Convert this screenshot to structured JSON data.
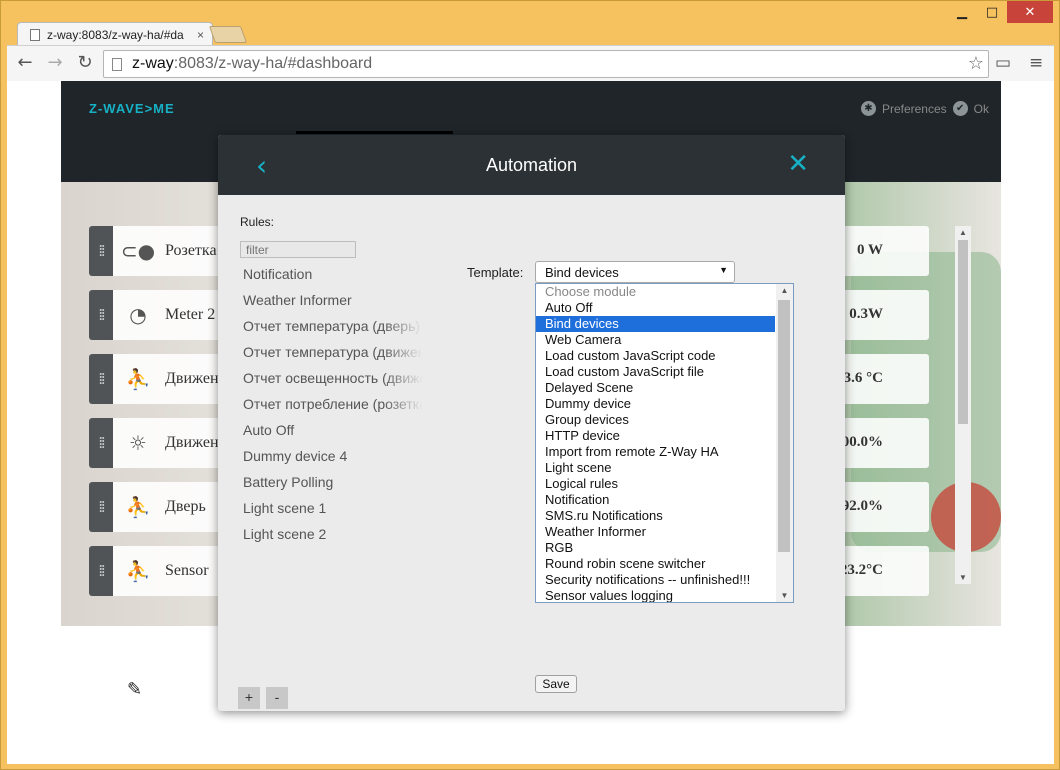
{
  "browser": {
    "tab_title": "z-way:8083/z-way-ha/#da",
    "tab_close": "×",
    "url_host": "z-way",
    "url_rest": ":8083/z-way-ha/#dashboard",
    "controls": {
      "minimize": "▁",
      "maximize": "□",
      "close": "✕"
    }
  },
  "app": {
    "logo": "Z-WAVE>ME",
    "header_right_label": "Preferences",
    "header_ok_label": "Ok",
    "widgets": [
      {
        "icon": "toggle-icon",
        "name": "Розетка",
        "value": "0 W"
      },
      {
        "icon": "meter-icon",
        "name": "Meter 2",
        "value": "0.3W"
      },
      {
        "icon": "motion-icon",
        "name": "Движен",
        "value": "3.6 °C"
      },
      {
        "icon": "sun-icon",
        "name": "Движен",
        "value": "00.0%"
      },
      {
        "icon": "motion-icon",
        "name": "Дверь",
        "value": "92.0%"
      },
      {
        "icon": "motion-icon",
        "name": "Sensor",
        "value": "23.2°C"
      }
    ]
  },
  "modal": {
    "title": "Automation",
    "rules_label": "Rules:",
    "filter_placeholder": "filter",
    "rules": [
      "Notification",
      "Weather Informer",
      "Отчет температура (дверь)",
      "Отчет температура (движение)",
      "Отчет освещенность (движение)",
      "Отчет потребление (розетка)",
      "Auto Off",
      "Dummy device 4",
      "Battery Polling",
      "Light scene 1",
      "Light scene 2"
    ],
    "template_label": "Template:",
    "template_selected": "Bind devices",
    "template_options": [
      "Choose module",
      "Auto Off",
      "Bind devices",
      "Web Camera",
      "Load custom JavaScript code",
      "Load custom JavaScript file",
      "Delayed Scene",
      "Dummy device",
      "Group devices",
      "HTTP device",
      "Import from remote Z-Way HA",
      "Light scene",
      "Logical rules",
      "Notification",
      "SMS.ru Notifications",
      "Weather Informer",
      "RGB",
      "Round robin scene switcher",
      "Security notifications -- unfinished!!!",
      "Sensor values logging"
    ],
    "save_label": "Save",
    "add_label": "+",
    "remove_label": "-"
  },
  "colors": {
    "accent": "#17b1c6",
    "header": "#1f2529",
    "selection": "#1e6fdc"
  }
}
